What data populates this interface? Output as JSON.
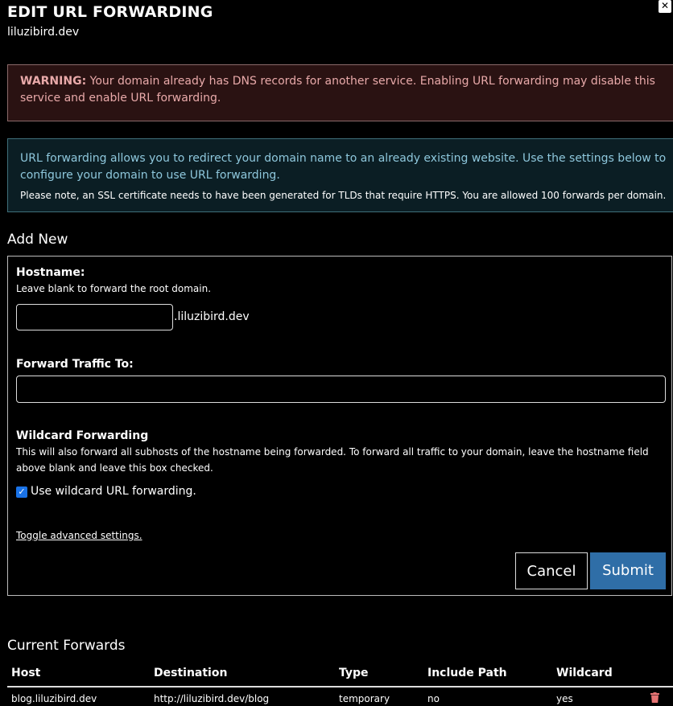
{
  "header": {
    "title": "EDIT URL FORWARDING",
    "domain": "liluzibird.dev",
    "close_icon": "close-icon"
  },
  "warning": {
    "label": "WARNING:",
    "text": " Your domain already has DNS records for another service. Enabling URL forwarding may disable this service and enable URL forwarding."
  },
  "info": {
    "text": "URL forwarding allows you to redirect your domain name to an already existing website. Use the settings below to configure your domain to use URL forwarding.",
    "note": "Please note, an SSL certificate needs to have been generated for TLDs that require HTTPS. You are allowed 100 forwards per domain."
  },
  "add_new": {
    "title": "Add New",
    "hostname_label": "Hostname:",
    "hostname_help": "Leave blank to forward the root domain.",
    "hostname_value": "",
    "hostname_suffix": ".liluzibird.dev",
    "forward_label": "Forward Traffic To:",
    "forward_value": "",
    "wildcard_label": "Wildcard Forwarding",
    "wildcard_help": "This will also forward all subhosts of the hostname being forwarded. To forward all traffic to your domain, leave the hostname field above blank and leave this box checked.",
    "wildcard_checkbox_label": "Use wildcard URL forwarding.",
    "wildcard_checked": true,
    "toggle_advanced": "Toggle advanced settings.",
    "cancel_label": "Cancel",
    "submit_label": "Submit"
  },
  "current": {
    "title": "Current Forwards",
    "columns": [
      "Host",
      "Destination",
      "Type",
      "Include Path",
      "Wildcard"
    ],
    "rows": [
      {
        "host": "blog.liluzibird.dev",
        "destination": "http://liluzibird.dev/blog",
        "type": "temporary",
        "include_path": "no",
        "wildcard": "yes",
        "delete_icon": "trash-icon"
      }
    ]
  },
  "colors": {
    "submit": "#2f6ea7",
    "warning_bg": "#2a1212",
    "info_bg": "#0b1e24",
    "delete_icon": "#e57373"
  }
}
